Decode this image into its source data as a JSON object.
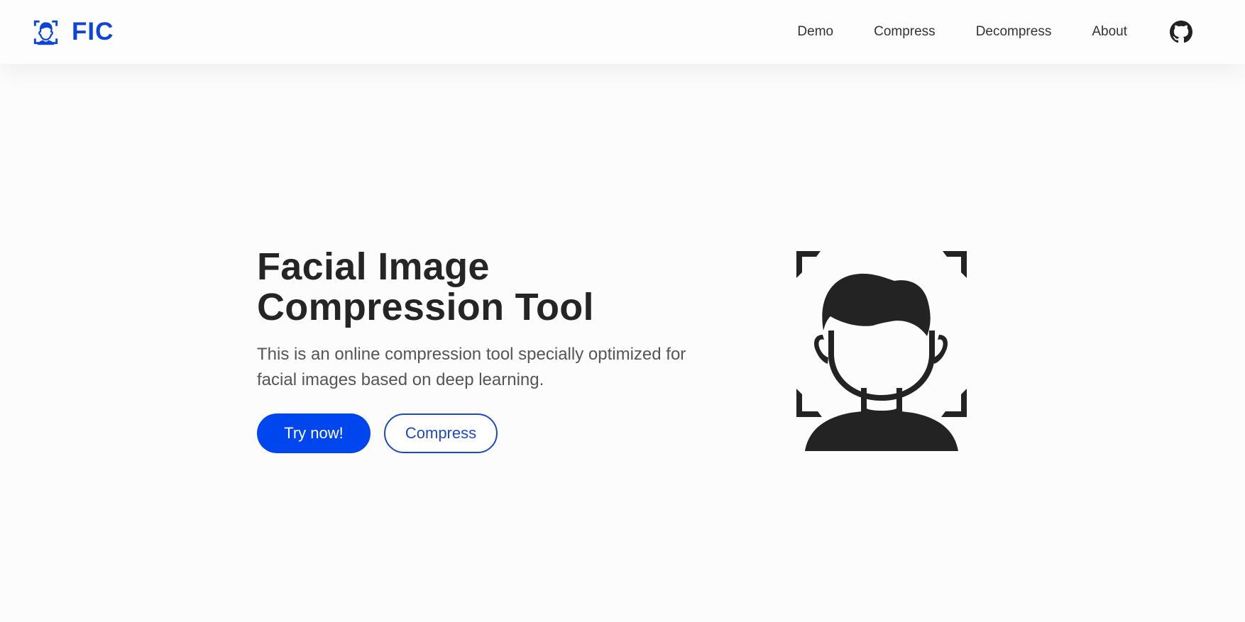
{
  "brand": {
    "name": "FIC",
    "icon": "face-scan-icon",
    "color": "#0b45de"
  },
  "nav": {
    "links": [
      "Demo",
      "Compress",
      "Decompress",
      "About"
    ],
    "github_icon": "github-icon"
  },
  "hero": {
    "title": "Facial Image Compression Tool",
    "description": "This is an online compression tool specially optimized for facial images based on deep learning.",
    "primary_button": "Try now!",
    "secondary_button": "Compress",
    "illustration_icon": "face-scan-icon"
  },
  "colors": {
    "accent": "#0046ef",
    "outline": "#1d49c6",
    "text": "#252525",
    "muted": "#555555"
  }
}
